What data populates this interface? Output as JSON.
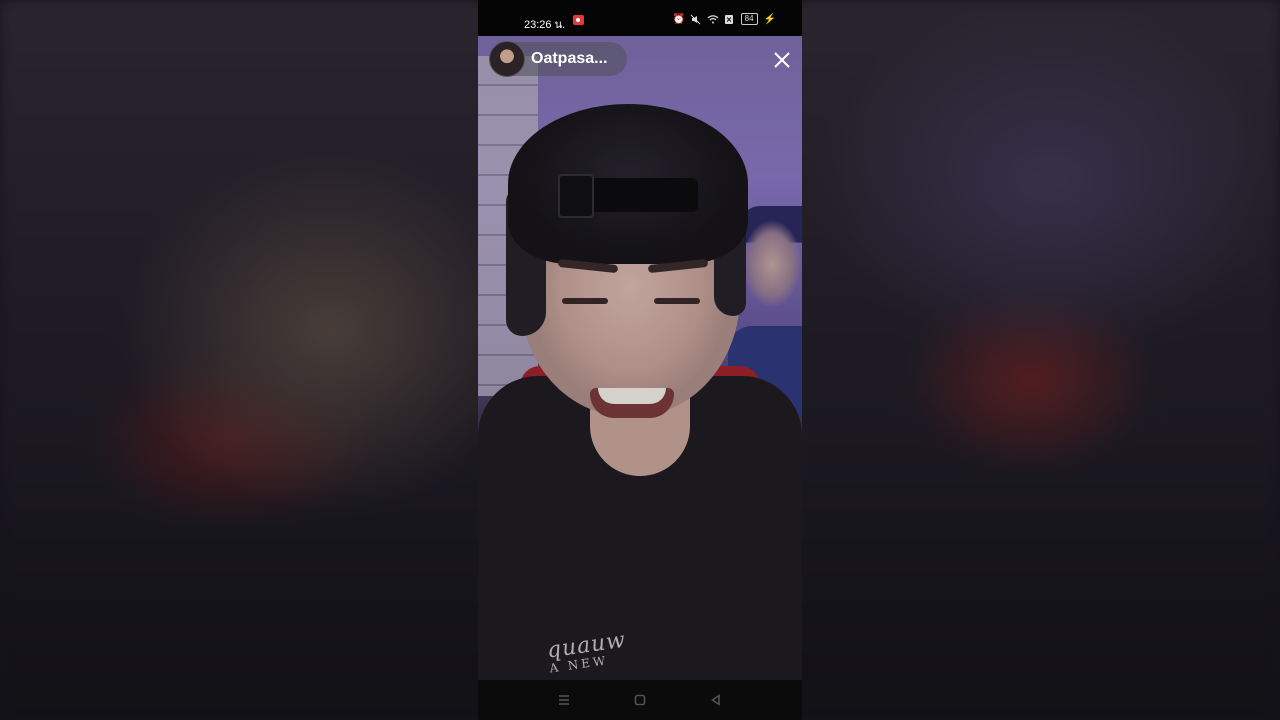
{
  "status_bar": {
    "time": "23:26 น.",
    "battery_level": "84",
    "icons": [
      "screen-record-icon",
      "alarm-icon",
      "mute-icon",
      "wifi-icon",
      "sim-off-icon",
      "battery-icon",
      "charging-icon"
    ]
  },
  "story": {
    "username": "Oatpasa...",
    "shirt_print_line1": "quauw",
    "shirt_print_line2": "A NEW"
  },
  "nav_bar": {
    "buttons": [
      "menu-icon",
      "home-icon",
      "back-icon"
    ]
  },
  "colors": {
    "accent_record": "#e53935",
    "charging": "#6ee07a",
    "chip_background": "rgba(80,80,90,0.55)"
  }
}
